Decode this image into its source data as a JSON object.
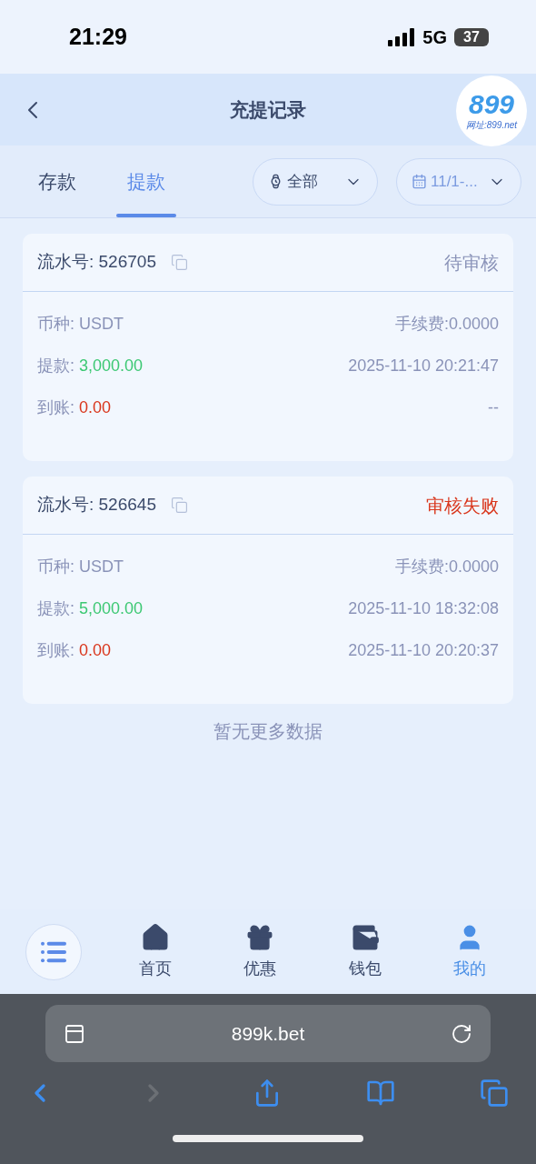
{
  "status_bar": {
    "time": "21:29",
    "network": "5G",
    "battery": "37"
  },
  "header": {
    "title": "充提记录",
    "logo": {
      "mark": "899",
      "site": "网址:899.net"
    }
  },
  "tabs": [
    {
      "label": "存款",
      "selected": false
    },
    {
      "label": "提款",
      "selected": true
    }
  ],
  "filters": [
    {
      "kind": "type",
      "label": "全部"
    },
    {
      "kind": "date",
      "label": "11/1-..."
    }
  ],
  "records": [
    {
      "serial": "流水号: 526705",
      "status": "待审核",
      "kind": "pending",
      "rows": [
        {
          "kind": "currency",
          "label": "币种: ",
          "value": "USDT",
          "right": "手续费:0.0000"
        },
        {
          "kind": "withdraw",
          "label": "提款: ",
          "value": "3,000.00",
          "right": "2025-11-10 20:21:47"
        },
        {
          "kind": "received",
          "label": "到账: ",
          "value": "0.00",
          "right": "--"
        }
      ]
    },
    {
      "serial": "流水号: 526645",
      "status": "审核失败",
      "kind": "failed",
      "rows": [
        {
          "kind": "currency",
          "label": "币种: ",
          "value": "USDT",
          "right": "手续费:0.0000"
        },
        {
          "kind": "withdraw",
          "label": "提款: ",
          "value": "5,000.00",
          "right": "2025-11-10 18:32:08"
        },
        {
          "kind": "received",
          "label": "到账: ",
          "value": "0.00",
          "right": "2025-11-10 20:20:37"
        }
      ]
    }
  ],
  "end_note": "暂无更多数据",
  "bottom_nav": [
    {
      "kind": "home",
      "label": "首页",
      "selected": false
    },
    {
      "kind": "gift",
      "label": "优惠",
      "selected": false
    },
    {
      "kind": "wallet",
      "label": "钱包",
      "selected": false
    },
    {
      "kind": "user",
      "label": "我的",
      "selected": true
    }
  ],
  "browser": {
    "url": "899k.bet"
  }
}
